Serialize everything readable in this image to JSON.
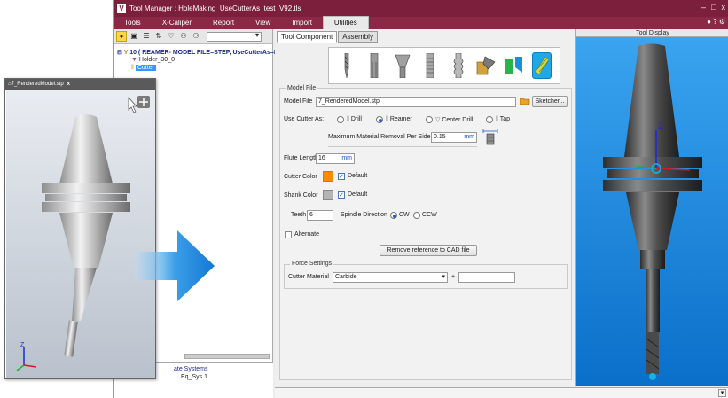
{
  "app": {
    "logo": "V",
    "title": "Tool Manager : HoleMaking_UseCutterAs_test_V92.tls",
    "window_controls": [
      "–",
      "□",
      "x"
    ],
    "help_icons": "● ? ⚙"
  },
  "menu": {
    "items": [
      "Tools",
      "X-Caliper",
      "Report",
      "View",
      "Import",
      "Utilities"
    ],
    "active": "Utilities"
  },
  "tree": {
    "root": "10 ( REAMER- MODEL FILE=STEP, UseCutterAs=R",
    "holder": "Holder_30_0",
    "cutter": "Cutter",
    "bottom_item1": "ate Systems",
    "bottom_item2": "Eq_Sys 1"
  },
  "tabs": [
    "Tool Component",
    "Assembly"
  ],
  "model_file": {
    "group_title": "Model File",
    "label": "Model File",
    "value": "7_RenderedModel.stp",
    "sketcher_button": "Sketcher...",
    "use_cutter_as_label": "Use Cutter As:",
    "options": [
      "Drill",
      "Reamer",
      "Center Drill",
      "Tap"
    ],
    "selected_option": "Reamer",
    "max_removal_label": "Maximum Material Removal Per Side",
    "max_removal_value": "0.15",
    "max_removal_unit": "mm",
    "flute_length_label": "Flute Length",
    "flute_length_value": "16",
    "flute_length_unit": "mm",
    "cutter_color_label": "Cutter Color",
    "cutter_color": "#ff8c00",
    "shank_color_label": "Shank Color",
    "shank_color": "#b4b4b4",
    "default_label": "Default",
    "teeth_label": "Teeth",
    "teeth_value": "6",
    "spindle_label": "Spindle Direction",
    "spindle_options": [
      "CW",
      "CCW"
    ],
    "spindle_selected": "CW",
    "alternate_label": "Alternate",
    "remove_cad_button": "Remove reference to CAD file"
  },
  "force_settings": {
    "group_title": "Force Settings",
    "material_label": "Cutter Material",
    "material_value": "Carbide",
    "plus": "+"
  },
  "display": {
    "header": "Tool Display"
  },
  "float_window": {
    "title": "7_RenderedModel.stp",
    "close": "x"
  },
  "colors": {
    "titlebar": "#7b1f3c",
    "menubar": "#8a2845",
    "display_bg": "#1c8de0",
    "selected_icon": "#1ea8e8"
  }
}
